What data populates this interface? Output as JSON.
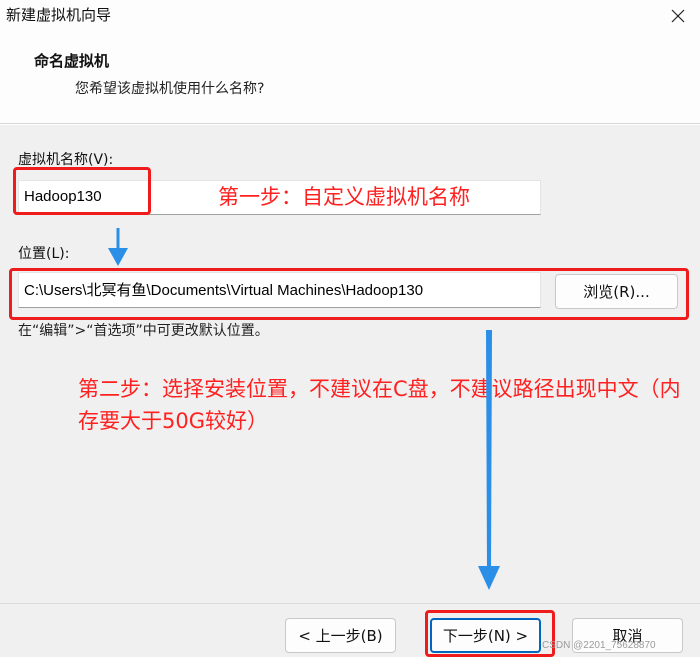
{
  "window": {
    "title": "新建虚拟机向导"
  },
  "header": {
    "title": "命名虚拟机",
    "subtitle": "您希望该虚拟机使用什么名称?"
  },
  "form": {
    "name_label": "虚拟机名称(V):",
    "name_value": "Hadoop130",
    "location_label": "位置(L):",
    "location_value": "C:\\Users\\北冥有鱼\\Documents\\Virtual Machines\\Hadoop130",
    "browse_label": "浏览(R)...",
    "hint": "在“编辑”>“首选项”中可更改默认位置。"
  },
  "annotations": {
    "step1": "第一步：自定义虚拟机名称",
    "step2": "第二步：选择安装位置，不建议在C盘，不建议路径出现中文（内存要大于50G较好）",
    "color": "#ff2020",
    "arrow_color": "#2b8fe8"
  },
  "footer": {
    "back_label": "< 上一步(B)",
    "next_label": "下一步(N) >",
    "cancel_label": "取消",
    "watermark": "CSDN @2201_75628870"
  },
  "icons": {
    "close": "close-icon"
  }
}
